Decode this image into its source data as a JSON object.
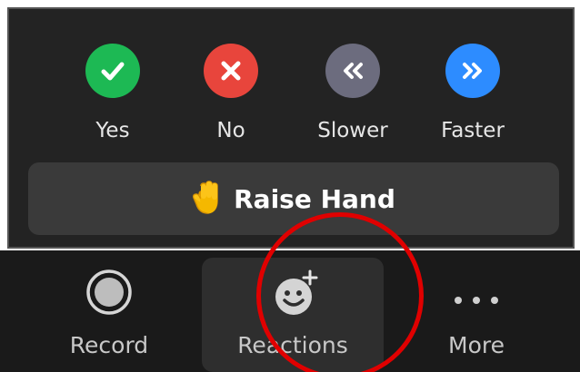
{
  "reactions_panel": {
    "feedback": [
      {
        "label": "Yes",
        "icon": "check-icon",
        "color": "#1db954"
      },
      {
        "label": "No",
        "icon": "x-icon",
        "color": "#e8453c"
      },
      {
        "label": "Slower",
        "icon": "double-chevron-left-icon",
        "color": "#6c6c7e"
      },
      {
        "label": "Faster",
        "icon": "double-chevron-right-icon",
        "color": "#2d8cff"
      }
    ],
    "raise_hand": {
      "label": "Raise Hand",
      "icon": "raised-hand-icon"
    }
  },
  "toolbar": {
    "record": {
      "label": "Record",
      "icon": "record-icon"
    },
    "reactions": {
      "label": "Reactions",
      "icon": "add-reaction-smiley-icon"
    },
    "more": {
      "label": "More",
      "icon": "more-dots-icon"
    }
  },
  "annotation": {
    "color": "#e00000",
    "target": "toolbar.reactions"
  }
}
